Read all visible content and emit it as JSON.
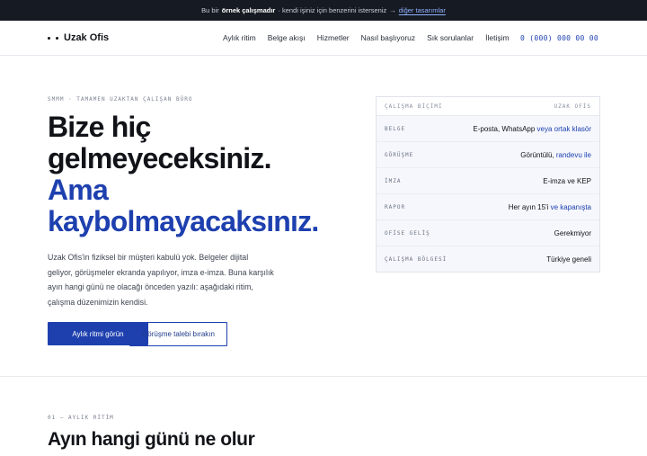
{
  "topbar": {
    "prefix": "Bu bir",
    "bold": "örnek çalışmadır",
    "middle": "· kendi işiniz için benzerini isterseniz",
    "arrow": "→",
    "link": "diğer tasarımlar"
  },
  "nav": {
    "brand": "Uzak Ofis",
    "menu": [
      "Aylık ritim",
      "Belge akışı",
      "Hizmetler",
      "Nasıl başlıyoruz",
      "Sık sorulanlar",
      "İletişim"
    ],
    "phone": "0 (000) 000 00 00"
  },
  "hero": {
    "kicker": "SMMM · TAMAMEN UZAKTAN ÇALIŞAN BÜRO",
    "title_lines": [
      "Bize hiç",
      "gelmeyeceksiniz."
    ],
    "title_blue_lines": [
      "Ama",
      "kaybolmayacaksınız."
    ],
    "lede_lines": [
      "Uzak Ofis'in fiziksel bir müşteri kabulü yok. Belgeler dijital",
      "geliyor, görüşmeler ekranda yapılıyor, imza e-imza. Buna karşılık",
      "ayın hangi günü ne olacağı önceden yazılı: aşağıdaki ritim,",
      "çalışma düzenimizin kendisi."
    ],
    "primary_button": "Aylık ritmi görün",
    "secondary_button": "Görüşme talebi bırakın"
  },
  "card": {
    "head_left": "ÇALIŞMA BİÇİMİ",
    "head_right": "UZAK OFİS",
    "rows": [
      {
        "key": "BELGE",
        "value": "E-posta, WhatsApp",
        "highlight": "veya ortak klasör"
      },
      {
        "key": "GÖRÜŞME",
        "value": "Görüntülü,",
        "highlight": "randevu ile"
      },
      {
        "key": "İMZA",
        "value": "E-imza ve KEP",
        "highlight": ""
      },
      {
        "key": "RAPOR",
        "value": "Her ayın 15'i",
        "highlight": "ve kapanışta"
      },
      {
        "key": "OFİSE GELİŞ",
        "value": "Gerekmiyor",
        "highlight": ""
      },
      {
        "key": "ÇALIŞMA BÖLGESİ",
        "value": "Türkiye geneli",
        "highlight": ""
      }
    ]
  },
  "section": {
    "kicker": "01 — AYLIK RİTİM",
    "title": "Ayın hangi günü ne olur"
  }
}
